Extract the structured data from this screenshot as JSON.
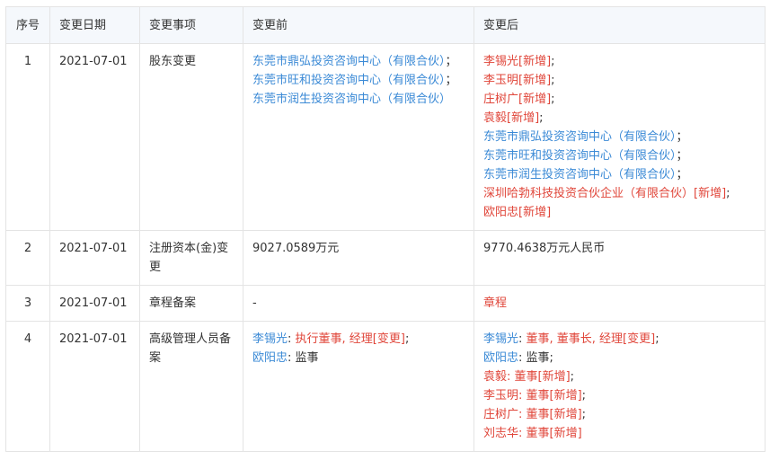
{
  "headers": [
    "序号",
    "变更日期",
    "变更事项",
    "变更前",
    "变更后"
  ],
  "rows": [
    {
      "idx": "1",
      "date": "2021-07-01",
      "item": "股东变更",
      "before": [
        {
          "segs": [
            {
              "text": "东莞市鼎弘投资咨询中心（有限合伙）",
              "color": "blue"
            },
            {
              "text": "；",
              "color": "dark"
            }
          ]
        },
        {
          "segs": [
            {
              "text": "东莞市旺和投资咨询中心（有限合伙）",
              "color": "blue"
            },
            {
              "text": "；",
              "color": "dark"
            }
          ]
        },
        {
          "segs": [
            {
              "text": "东莞市润生投资咨询中心（有限合伙）",
              "color": "blue"
            }
          ]
        }
      ],
      "after": [
        {
          "segs": [
            {
              "text": "李锡光[新增]",
              "color": "red"
            },
            {
              "text": ";",
              "color": "dark"
            }
          ]
        },
        {
          "segs": [
            {
              "text": "李玉明[新增]",
              "color": "red"
            },
            {
              "text": ";",
              "color": "dark"
            }
          ]
        },
        {
          "segs": [
            {
              "text": "庄树广[新增]",
              "color": "red"
            },
            {
              "text": ";",
              "color": "dark"
            }
          ]
        },
        {
          "segs": [
            {
              "text": "袁毅[新增]",
              "color": "red"
            },
            {
              "text": ";",
              "color": "dark"
            }
          ]
        },
        {
          "segs": [
            {
              "text": "东莞市鼎弘投资咨询中心（有限合伙）",
              "color": "blue"
            },
            {
              "text": "；",
              "color": "dark"
            }
          ]
        },
        {
          "segs": [
            {
              "text": "东莞市旺和投资咨询中心（有限合伙）",
              "color": "blue"
            },
            {
              "text": "；",
              "color": "dark"
            }
          ]
        },
        {
          "segs": [
            {
              "text": "东莞市润生投资咨询中心（有限合伙）",
              "color": "blue"
            },
            {
              "text": "；",
              "color": "dark"
            }
          ]
        },
        {
          "segs": [
            {
              "text": "深圳哈勃科技投资合伙企业（有限合伙）[新增]",
              "color": "red"
            },
            {
              "text": ";",
              "color": "dark"
            }
          ]
        },
        {
          "segs": [
            {
              "text": "欧阳忠[新增]",
              "color": "red"
            }
          ]
        }
      ]
    },
    {
      "idx": "2",
      "date": "2021-07-01",
      "item": "注册资本(金)变更",
      "before": [
        {
          "segs": [
            {
              "text": "9027.0589万元",
              "color": "dark"
            }
          ]
        }
      ],
      "after": [
        {
          "segs": [
            {
              "text": "9770.4638万元人民币",
              "color": "dark"
            }
          ]
        }
      ]
    },
    {
      "idx": "3",
      "date": "2021-07-01",
      "item": "章程备案",
      "before": [
        {
          "segs": [
            {
              "text": "-",
              "color": "dark"
            }
          ]
        }
      ],
      "after": [
        {
          "segs": [
            {
              "text": "章程",
              "color": "red"
            }
          ]
        }
      ]
    },
    {
      "idx": "4",
      "date": "2021-07-01",
      "item": "高级管理人员备案",
      "before": [
        {
          "segs": [
            {
              "text": "李锡光",
              "color": "blue"
            },
            {
              "text": ": ",
              "color": "dark"
            },
            {
              "text": "执行董事, 经理[变更]",
              "color": "red"
            },
            {
              "text": ";",
              "color": "dark"
            }
          ]
        },
        {
          "segs": [
            {
              "text": "欧阳忠",
              "color": "blue"
            },
            {
              "text": ": 监事",
              "color": "dark"
            }
          ]
        }
      ],
      "after": [
        {
          "segs": [
            {
              "text": "李锡光",
              "color": "blue"
            },
            {
              "text": ": ",
              "color": "dark"
            },
            {
              "text": "董事, 董事长, 经理[变更]",
              "color": "red"
            },
            {
              "text": ";",
              "color": "dark"
            }
          ]
        },
        {
          "segs": [
            {
              "text": "欧阳忠",
              "color": "blue"
            },
            {
              "text": ": 监事;",
              "color": "dark"
            }
          ]
        },
        {
          "segs": [
            {
              "text": "袁毅: 董事[新增]",
              "color": "red"
            },
            {
              "text": ";",
              "color": "dark"
            }
          ]
        },
        {
          "segs": [
            {
              "text": "李玉明: 董事[新增]",
              "color": "red"
            },
            {
              "text": ";",
              "color": "dark"
            }
          ]
        },
        {
          "segs": [
            {
              "text": "庄树广: 董事[新增]",
              "color": "red"
            },
            {
              "text": ";",
              "color": "dark"
            }
          ]
        },
        {
          "segs": [
            {
              "text": "刘志华: 董事[新增]",
              "color": "red"
            }
          ]
        }
      ]
    }
  ]
}
